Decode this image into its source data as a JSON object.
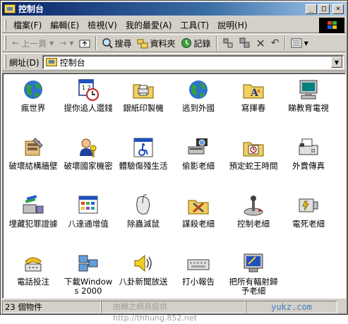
{
  "window": {
    "title": "控制台"
  },
  "caption_buttons": {
    "minimize": "_",
    "maximize": "□",
    "close": "×"
  },
  "menu": [
    "檔案(F)",
    "編輯(E)",
    "檢視(V)",
    "我的最愛(A)",
    "工具(T)",
    "說明(H)"
  ],
  "toolbar": {
    "back": "上一頁",
    "forward": "→",
    "search": "搜尋",
    "folders": "資料夾",
    "history": "記錄"
  },
  "address": {
    "label": "網址(D)",
    "value": "控制台"
  },
  "items": [
    {
      "label": "瘋世界",
      "icon": "globe-icon"
    },
    {
      "label": "提你追人還錢",
      "icon": "calendar-clock-icon"
    },
    {
      "label": "銀紙印製機",
      "icon": "printer-folder-icon"
    },
    {
      "label": "逃到外國",
      "icon": "globe-icon"
    },
    {
      "label": "寫揮春",
      "icon": "fonts-folder-icon"
    },
    {
      "label": "睇教育電視",
      "icon": "monitor-icon"
    },
    {
      "label": "破壞結構牆壁",
      "icon": "admin-tools-icon"
    },
    {
      "label": "破壞國家機密",
      "icon": "users-keys-icon"
    },
    {
      "label": "體驗傷殘生活",
      "icon": "accessibility-icon"
    },
    {
      "label": "偷影老細",
      "icon": "scanner-camera-icon"
    },
    {
      "label": "預定蛇王時間",
      "icon": "scheduled-tasks-icon"
    },
    {
      "label": "外賣傳真",
      "icon": "fax-icon"
    },
    {
      "label": "埋藏犯罪證據",
      "icon": "add-remove-icon"
    },
    {
      "label": "八達通增值",
      "icon": "display-icon"
    },
    {
      "label": "除蟲滅鼠",
      "icon": "mouse-icon"
    },
    {
      "label": "謀殺老細",
      "icon": "system-tools-icon"
    },
    {
      "label": "控制老細",
      "icon": "joystick-icon"
    },
    {
      "label": "電死老細",
      "icon": "power-icon"
    },
    {
      "label": "電話投注",
      "icon": "phone-modem-icon"
    },
    {
      "label": "下載Windows 2000",
      "icon": "network-icon"
    },
    {
      "label": "八卦新聞放送",
      "icon": "speaker-icon"
    },
    {
      "label": "打小報告",
      "icon": "keyboard-icon"
    },
    {
      "label": "把所有輻射歸予老細",
      "icon": "display-settings-icon"
    }
  ],
  "status": {
    "count": "23 個物件",
    "watermark": "由轉之網頁提供 http://thhung.852.net",
    "site": "yukz.com"
  },
  "colors": {
    "titlebar_start": "#0a246a",
    "titlebar_end": "#a6caf0",
    "chrome": "#d4d0c8"
  }
}
